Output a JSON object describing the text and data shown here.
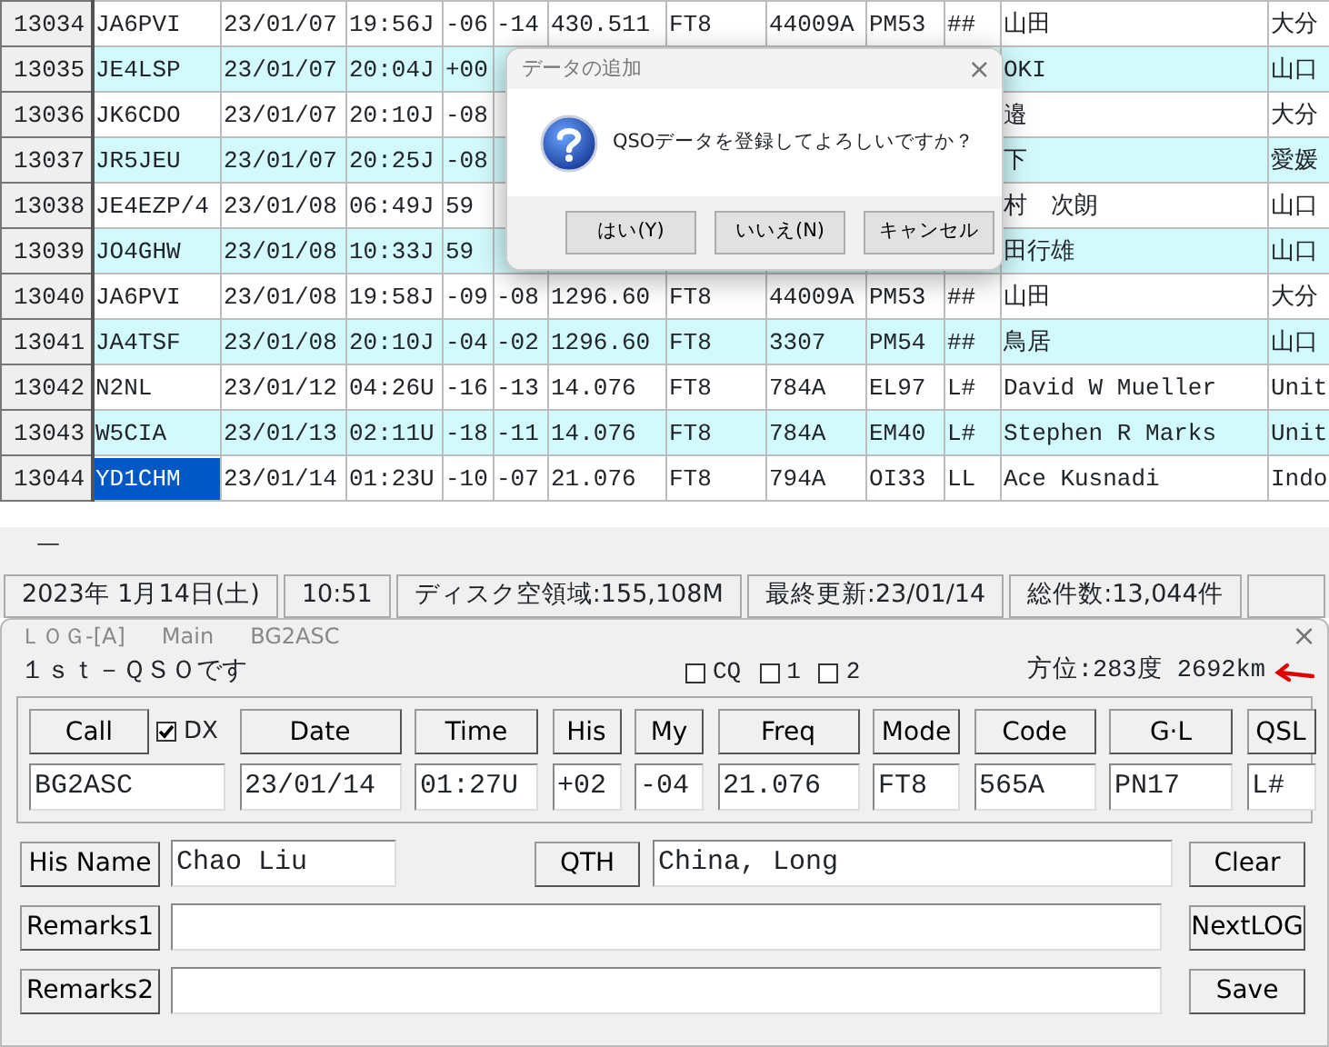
{
  "log_table": {
    "rows": [
      {
        "no": "13034",
        "call": "JA6PVI",
        "call_selected": false,
        "date": "23/01/07",
        "time": "19:56J",
        "his": "-06",
        "my": "-14",
        "freq": "430.511",
        "mode": "FT8",
        "code": "44009A",
        "gl": "PM53",
        "qsl": "##",
        "name": "山田",
        "qth": "大分"
      },
      {
        "no": "13035",
        "call": "JE4LSP",
        "call_selected": false,
        "date": "23/01/07",
        "time": "20:04J",
        "his": "+00",
        "name": "OKI",
        "qth": "山口"
      },
      {
        "no": "13036",
        "call": "JK6CDO",
        "call_selected": false,
        "date": "23/01/07",
        "time": "20:10J",
        "his": "-08",
        "name": "邉",
        "qth": "大分"
      },
      {
        "no": "13037",
        "call": "JR5JEU",
        "call_selected": false,
        "date": "23/01/07",
        "time": "20:25J",
        "his": "-08",
        "name": "下",
        "qth": "愛媛"
      },
      {
        "no": "13038",
        "call": "JE4EZP/4",
        "call_selected": false,
        "date": "23/01/08",
        "time": "06:49J",
        "his": "59",
        "name": "村　次朗",
        "qth": "山口"
      },
      {
        "no": "13039",
        "call": "JO4GHW",
        "call_selected": false,
        "date": "23/01/08",
        "time": "10:33J",
        "his": "59",
        "name": "田行雄",
        "qth": "山口"
      },
      {
        "no": "13040",
        "call": "JA6PVI",
        "call_selected": false,
        "date": "23/01/08",
        "time": "19:58J",
        "his": "-09",
        "my": "-08",
        "freq": "1296.60",
        "mode": "FT8",
        "code": "44009A",
        "gl": "PM53",
        "qsl": "##",
        "name": "山田",
        "qth": "大分"
      },
      {
        "no": "13041",
        "call": "JA4TSF",
        "call_selected": false,
        "date": "23/01/08",
        "time": "20:10J",
        "his": "-04",
        "my": "-02",
        "freq": "1296.60",
        "mode": "FT8",
        "code": "3307",
        "gl": "PM54",
        "qsl": "##",
        "name": "鳥居",
        "qth": "山口"
      },
      {
        "no": "13042",
        "call": "N2NL",
        "call_selected": false,
        "date": "23/01/12",
        "time": "04:26U",
        "his": "-16",
        "my": "-13",
        "freq": "14.076",
        "mode": "FT8",
        "code": "784A",
        "gl": "EL97",
        "qsl": "L#",
        "name": "David W Mueller",
        "qth": "Unit"
      },
      {
        "no": "13043",
        "call": "W5CIA",
        "call_selected": false,
        "date": "23/01/13",
        "time": "02:11U",
        "his": "-18",
        "my": "-11",
        "freq": "14.076",
        "mode": "FT8",
        "code": "784A",
        "gl": "EM40",
        "qsl": "L#",
        "name": "Stephen R Marks",
        "qth": "Unit"
      },
      {
        "no": "13044",
        "call": "YD1CHM",
        "call_selected": true,
        "date": "23/01/14",
        "time": "01:23U",
        "his": "-10",
        "my": "-07",
        "freq": "21.076",
        "mode": "FT8",
        "code": "794A",
        "gl": "OI33",
        "qsl": "LL",
        "name": "Ace Kusnadi",
        "qth": "Indo"
      }
    ]
  },
  "dialog": {
    "title": "データの追加",
    "close": "×",
    "message": "QSOデータを登録してよろしいですか？",
    "buttons": [
      "はい(Y)",
      "いいえ(N)",
      "キャンセル"
    ]
  },
  "splitter": "—",
  "status_bar": [
    "2023年 1月14日(土)",
    "10:51",
    "ディスク空領域:155,108M",
    "最終更新:23/01/14",
    "総件数:13,044件"
  ],
  "log_window": {
    "title": "ＬＯＧ-[A]",
    "subtitle": "Main",
    "station": "BG2ASC",
    "close": "×",
    "message": "１ｓｔ－ＱＳＯです",
    "checkboxes": [
      {
        "label": "CQ",
        "checked": false
      },
      {
        "label": "1",
        "checked": false
      },
      {
        "label": "2",
        "checked": false
      }
    ],
    "bearing": "方位:283度 2692km",
    "fields": [
      {
        "button": "Call",
        "value": "BG2ASC",
        "dx": {
          "label": "DX",
          "checked": true
        }
      },
      {
        "button": "Date",
        "value": "23/01/14"
      },
      {
        "button": "Time",
        "value": "01:27U"
      },
      {
        "button": "His",
        "value": "+02"
      },
      {
        "button": "My",
        "value": "-04"
      },
      {
        "button": "Freq",
        "value": "21.076"
      },
      {
        "button": "Mode",
        "value": "FT8"
      },
      {
        "button": "Code",
        "value": "565A"
      },
      {
        "button": "G·L",
        "value": "PN17"
      },
      {
        "button": "QSL",
        "value": "L#"
      }
    ],
    "his_name": {
      "button": "His Name",
      "value": "Chao Liu"
    },
    "qth": {
      "button": "QTH",
      "value": "China, Long"
    },
    "remarks": [
      {
        "button": "Remarks1"
      },
      {
        "button": "Remarks2"
      }
    ],
    "side_buttons": [
      "Clear",
      "NextLOG",
      "Save"
    ]
  }
}
